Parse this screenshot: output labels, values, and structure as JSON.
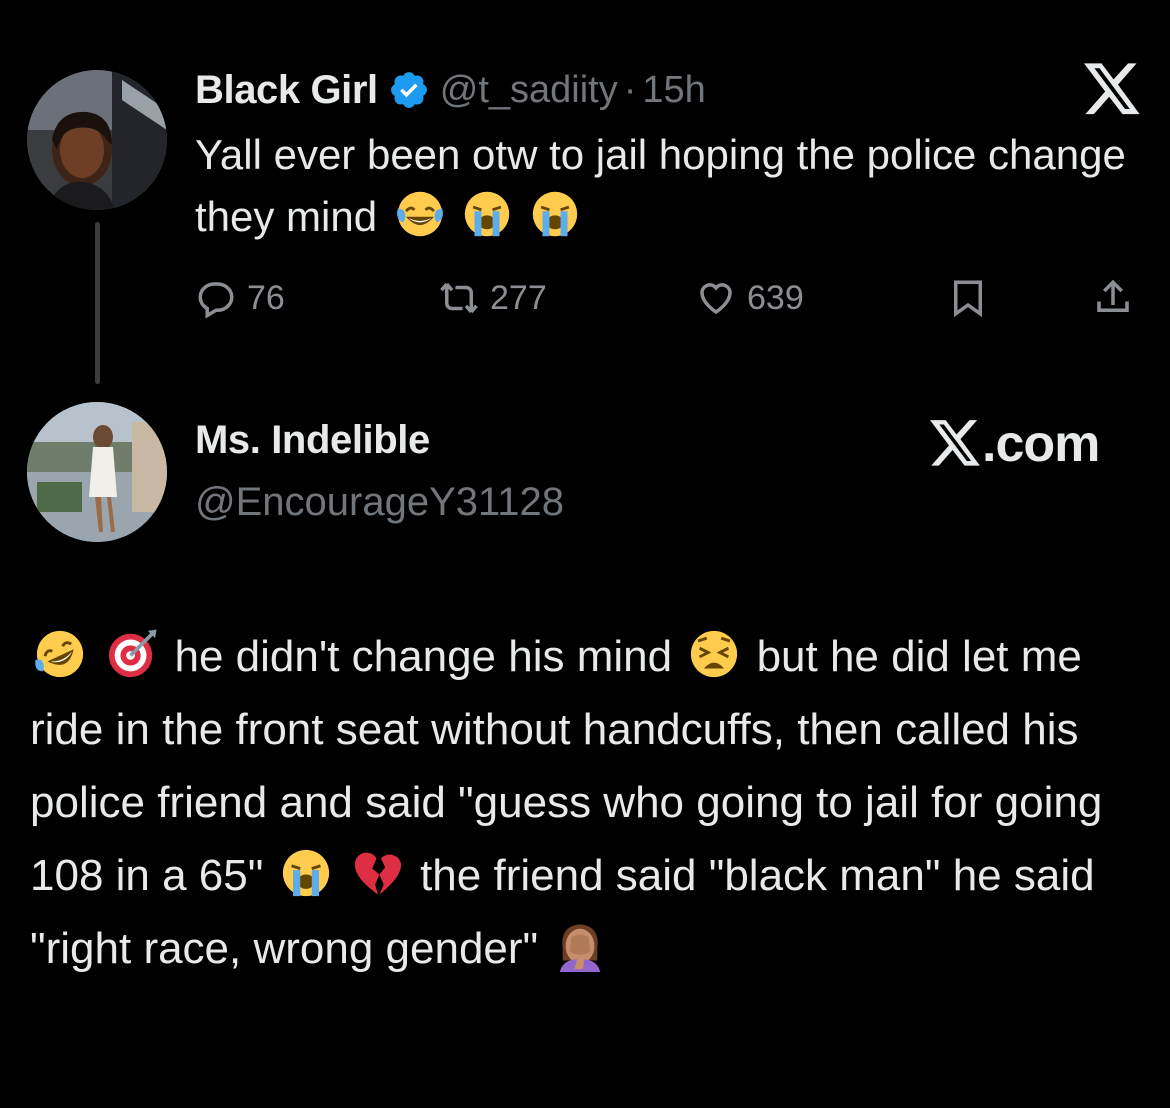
{
  "tweet": {
    "author_name": "Black Girl",
    "handle": "@t_sadiity",
    "separator": "·",
    "time": "15h",
    "text": "Yall ever been otw to jail hoping the police change they mind",
    "emojis": [
      "face-with-tears-of-joy",
      "loudly-crying-face",
      "loudly-crying-face"
    ],
    "actions": {
      "replies": "76",
      "retweets": "277",
      "likes": "639"
    }
  },
  "reply": {
    "author_name": "Ms. Indelible",
    "handle": "@EncourageY31128",
    "watermark": ".com",
    "text_segments": [
      "he didn't change his mind",
      "but he did let me ride in the front seat without handcuffs, then called his police friend and said \"guess who going to jail for going 108 in a 65\"",
      "the friend said \"black man\" he said \"right race, wrong gender\""
    ],
    "emojis": [
      "rolling-on-floor-laughing",
      "direct-hit",
      "weary-face",
      "loudly-crying-face",
      "broken-heart",
      "woman-facepalming"
    ]
  },
  "colors": {
    "background": "#000000",
    "primary_text": "#e7e9ea",
    "secondary_text": "#71767b",
    "verified_blue": "#1d9bf0",
    "thread_line": "#3a3d40"
  }
}
